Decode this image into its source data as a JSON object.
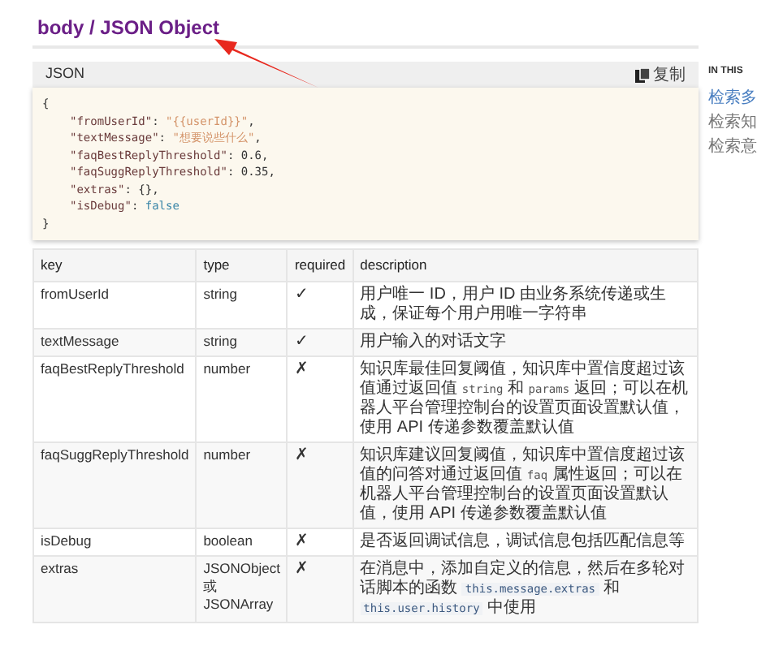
{
  "heading": "body / JSON Object",
  "code_panel": {
    "title": "JSON",
    "copy_label": "复制",
    "lines": [
      [
        {
          "text": "{",
          "kind": "punct"
        }
      ],
      [
        {
          "text": "\"fromUserId\"",
          "kind": "key"
        },
        {
          "text": ": ",
          "kind": "punct"
        },
        {
          "text": "\"{{userId}}\"",
          "kind": "string"
        },
        {
          "text": ",",
          "kind": "punct"
        }
      ],
      [
        {
          "text": "\"textMessage\"",
          "kind": "key"
        },
        {
          "text": ": ",
          "kind": "punct"
        },
        {
          "text": "\"想要说些什么\"",
          "kind": "string"
        },
        {
          "text": ",",
          "kind": "punct"
        }
      ],
      [
        {
          "text": "\"faqBestReplyThreshold\"",
          "kind": "key"
        },
        {
          "text": ": 0.6,",
          "kind": "punct"
        }
      ],
      [
        {
          "text": "\"faqSuggReplyThreshold\"",
          "kind": "key"
        },
        {
          "text": ": 0.35,",
          "kind": "punct"
        }
      ],
      [
        {
          "text": "\"extras\"",
          "kind": "key"
        },
        {
          "text": ": {},",
          "kind": "punct"
        }
      ],
      [
        {
          "text": "\"isDebug\"",
          "kind": "key"
        },
        {
          "text": ": ",
          "kind": "punct"
        },
        {
          "text": "false",
          "kind": "literal"
        }
      ],
      [
        {
          "text": "}",
          "kind": "punct"
        }
      ]
    ]
  },
  "table": {
    "columns": [
      "key",
      "type",
      "required",
      "description"
    ],
    "rows": [
      {
        "key": "fromUserId",
        "type": "string",
        "required": "✓",
        "description": [
          {
            "text": "用户唯一 ID，用户 ID 由业务系统传递或生成，保证每个用户用唯一字符串",
            "kind": "text"
          }
        ]
      },
      {
        "key": "textMessage",
        "type": "string",
        "required": "✓",
        "description": [
          {
            "text": "用户输入的对话文字",
            "kind": "text"
          }
        ]
      },
      {
        "key": "faqBestReplyThreshold",
        "type": "number",
        "required": "✗",
        "description": [
          {
            "text": "知识库最佳回复阈值，知识库中置信度超过该值通过返回值 ",
            "kind": "text"
          },
          {
            "text": "string",
            "kind": "code"
          },
          {
            "text": " 和 ",
            "kind": "text"
          },
          {
            "text": "params",
            "kind": "code"
          },
          {
            "text": " 返回；可以在机器人平台管理控制台的设置页面设置默认值，使用 API 传递参数覆盖默认值",
            "kind": "text"
          }
        ]
      },
      {
        "key": "faqSuggReplyThreshold",
        "type": "number",
        "required": "✗",
        "description": [
          {
            "text": "知识库建议回复阈值，知识库中置信度超过该值的问答对通过返回值 ",
            "kind": "text"
          },
          {
            "text": "faq",
            "kind": "code"
          },
          {
            "text": " 属性返回；可以在机器人平台管理控制台的设置页面设置默认值，使用 API 传递参数覆盖默认值",
            "kind": "text"
          }
        ]
      },
      {
        "key": "isDebug",
        "type": "boolean",
        "required": "✗",
        "description": [
          {
            "text": "是否返回调试信息，调试信息包括匹配信息等",
            "kind": "text"
          }
        ]
      },
      {
        "key": "extras",
        "type": "JSONObject 或 JSONArray",
        "required": "✗",
        "description": [
          {
            "text": "在消息中，添加自定义的信息，然后在多轮对话脚本的函数 ",
            "kind": "text"
          },
          {
            "text": "this.message.extras",
            "kind": "shaded_code"
          },
          {
            "text": " 和 ",
            "kind": "text"
          },
          {
            "text": "this.user.history",
            "kind": "shaded_code"
          },
          {
            "text": " 中使用",
            "kind": "text"
          }
        ]
      }
    ]
  },
  "sidebar": {
    "title": "IN THIS",
    "items": [
      {
        "label": "检索多",
        "selected": true
      },
      {
        "label": "检索知",
        "selected": false
      },
      {
        "label": "检索意",
        "selected": false
      }
    ]
  }
}
